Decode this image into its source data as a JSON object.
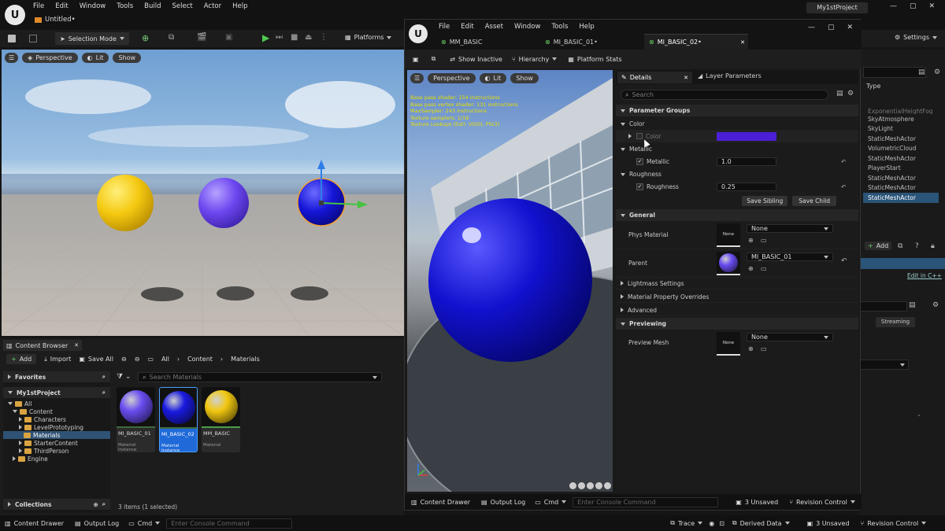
{
  "main_menu": [
    "File",
    "Edit",
    "Window",
    "Tools",
    "Build",
    "Select",
    "Actor",
    "Help"
  ],
  "level_tab": "Untitled•",
  "project_name": "My1stProject",
  "toolbar": {
    "selection_mode": "Selection Mode",
    "platforms": "Platforms",
    "settings": "Settings"
  },
  "viewport": {
    "perspective": "Perspective",
    "lit": "Lit",
    "show": "Show"
  },
  "outliner": {
    "type_header": "Type",
    "items": [
      "ExponentialHeightFog",
      "SkyAtmosphere",
      "SkyLight",
      "StaticMeshActor",
      "VolumetricCloud",
      "StaticMeshActor",
      "PlayerStart",
      "StaticMeshActor",
      "StaticMeshActor",
      "StaticMeshActor"
    ],
    "add": "Add",
    "edit_cpp": "Edit in C++",
    "streaming": "Streaming"
  },
  "content_browser": {
    "tab": "Content Browser",
    "add": "Add",
    "import": "Import",
    "save_all": "Save All",
    "path": [
      "All",
      "Content",
      "Materials"
    ],
    "search_placeholder": "Search Materials",
    "favorites": "Favorites",
    "project": "My1stProject",
    "tree": [
      {
        "label": "All",
        "level": 0
      },
      {
        "label": "Content",
        "level": 1
      },
      {
        "label": "Characters",
        "level": 2
      },
      {
        "label": "LevelPrototyping",
        "level": 2
      },
      {
        "label": "Materials",
        "level": 2
      },
      {
        "label": "StarterContent",
        "level": 2
      },
      {
        "label": "ThirdPerson",
        "level": 2
      },
      {
        "label": "Engine",
        "level": 1
      }
    ],
    "assets": [
      {
        "name": "MI_BASIC_01",
        "type": "Material Instance",
        "color": "#6a4df0",
        "selected": false
      },
      {
        "name": "MI_BASIC_02",
        "type": "Material Instance",
        "color": "#1a1ae0",
        "selected": true
      },
      {
        "name": "MM_BASIC",
        "type": "Material",
        "color": "#f2c811",
        "selected": false
      }
    ],
    "collections": "Collections",
    "count": "3 items (1 selected)"
  },
  "bottom_bar": {
    "drawer": "Content Drawer",
    "output": "Output Log",
    "cmd": "Cmd",
    "console_placeholder": "Enter Console Command",
    "trace": "Trace",
    "derived": "Derived Data",
    "unsaved": "3 Unsaved",
    "revision": "Revision Control"
  },
  "mat_editor": {
    "menu": [
      "File",
      "Edit",
      "Asset",
      "Window",
      "Tools",
      "Help"
    ],
    "tabs": [
      "MM_BASIC",
      "MI_BASIC_01•",
      "MI_BASIC_02•"
    ],
    "toolbar": {
      "show_inactive": "Show Inactive",
      "hierarchy": "Hierarchy",
      "platform_stats": "Platform Stats"
    },
    "viewport": {
      "perspective": "Perspective",
      "lit": "Lit",
      "show": "Show"
    },
    "stats": [
      "Base pass shader: 154 instructions",
      "Base pass vertex shader: 131 instructions",
      "MaxSampler: 243 instructions",
      "Texture samplers: 1/16",
      "Texture Lookups (Est): VS(0), PS(3)"
    ],
    "details_tab": "Details",
    "layer_tab": "Layer Parameters",
    "search_placeholder": "Search",
    "param_groups": "Parameter Groups",
    "color_group": "Color",
    "color_label": "Color",
    "color_value": "#4b1fd6",
    "metallic_group": "Metallic",
    "metallic_label": "Metallic",
    "metallic_value": "1.0",
    "roughness_group": "Roughness",
    "roughness_label": "Roughness",
    "roughness_value": "0.25",
    "save_sibling": "Save Sibling",
    "save_child": "Save Child",
    "general": "General",
    "phys_material": "Phys Material",
    "phys_value": "None",
    "parent": "Parent",
    "parent_value": "MI_BASIC_01",
    "thumb_none": "None",
    "collapsed": [
      "Lightmass Settings",
      "Material Property Overrides",
      "Advanced"
    ],
    "previewing": "Previewing",
    "preview_mesh": "Preview Mesh",
    "preview_value": "None",
    "bottom": {
      "drawer": "Content Drawer",
      "output": "Output Log",
      "cmd": "Cmd",
      "console_placeholder": "Enter Console Command",
      "unsaved": "3 Unsaved",
      "revision": "Revision Control"
    }
  }
}
